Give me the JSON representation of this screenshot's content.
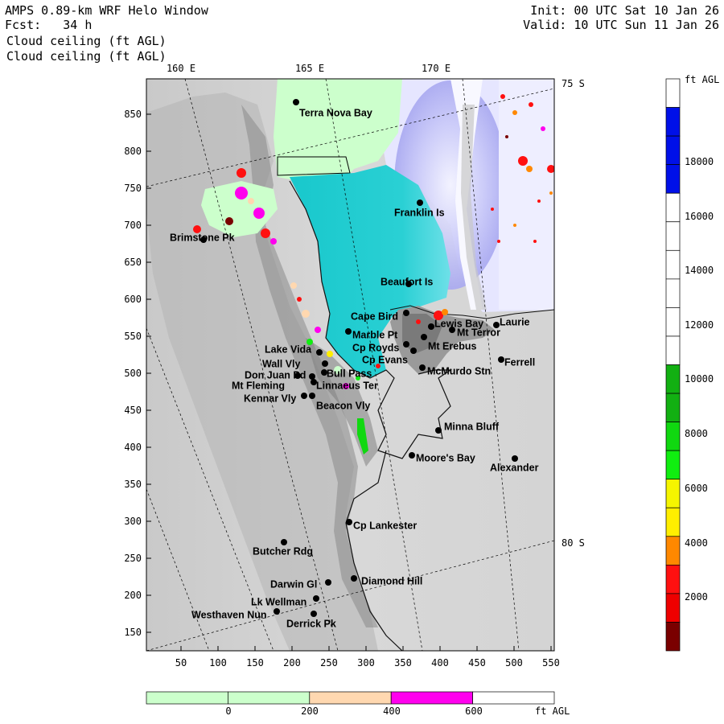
{
  "header": {
    "title": "AMPS 0.89-km WRF Helo Window",
    "forecast": "Fcst:   34 h",
    "field_line1": "Cloud ceiling (ft AGL)",
    "field_line2": "Cloud ceiling (ft AGL)",
    "init": "Init: 00 UTC Sat 10 Jan 26",
    "valid": "Valid: 10 UTC Sun 11 Jan 26"
  },
  "map": {
    "lon_labels": [
      "160 E",
      "165 E",
      "170 E"
    ],
    "lat_labels": [
      "75 S",
      "80 S"
    ],
    "x_ticks": [
      "50",
      "100",
      "150",
      "200",
      "250",
      "300",
      "350",
      "400",
      "450",
      "500",
      "550"
    ],
    "y_ticks": [
      "850",
      "800",
      "750",
      "700",
      "650",
      "600",
      "550",
      "500",
      "450",
      "400",
      "350",
      "300",
      "250",
      "200",
      "150"
    ],
    "places": [
      {
        "name": "Terra Nova Bay"
      },
      {
        "name": "Franklin Is"
      },
      {
        "name": "Brimstone Pk"
      },
      {
        "name": "Beaufort Is"
      },
      {
        "name": "Cape Bird"
      },
      {
        "name": "Lewis Bay"
      },
      {
        "name": "Laurie"
      },
      {
        "name": "Mt Terror"
      },
      {
        "name": "Marble Pt"
      },
      {
        "name": "Cp Royds"
      },
      {
        "name": "Mt Erebus"
      },
      {
        "name": "Lake Vida"
      },
      {
        "name": "Cp Evans"
      },
      {
        "name": "Ferrell"
      },
      {
        "name": "Wall Vly"
      },
      {
        "name": "Bull Pass"
      },
      {
        "name": "McMurdo Stn"
      },
      {
        "name": "Don Juan Pd"
      },
      {
        "name": "Mt Fleming"
      },
      {
        "name": "Linnaeus Ter"
      },
      {
        "name": "Kennar Vly"
      },
      {
        "name": "Beacon Vly"
      },
      {
        "name": "Minna Bluff"
      },
      {
        "name": "Moore's Bay"
      },
      {
        "name": "Alexander"
      },
      {
        "name": "Cp Lankester"
      },
      {
        "name": "Butcher Rdg"
      },
      {
        "name": "Darwin Gl"
      },
      {
        "name": "Diamond Hill"
      },
      {
        "name": "Lk Wellman"
      },
      {
        "name": "Westhaven Nun"
      },
      {
        "name": "Derrick Pk"
      }
    ]
  },
  "colorbar_right": {
    "unit": "ft AGL",
    "labels": [
      "18000",
      "16000",
      "14000",
      "12000",
      "10000",
      "8000",
      "6000",
      "4000",
      "2000"
    ],
    "colors": [
      "#ffffff",
      "#0010e8",
      "#0010e8",
      "#0010e8",
      "#ffffff",
      "#ffffff",
      "#ffffff",
      "#ffffff",
      "#ffffff",
      "#ffffff",
      "#12b012",
      "#12b012",
      "#10d810",
      "#10ee10",
      "#f5f500",
      "#ffee00",
      "#ff8800",
      "#ff1010",
      "#ee0000",
      "#7a0000"
    ]
  },
  "colorbar_bottom": {
    "unit": "ft AGL",
    "labels": [
      "0",
      "200",
      "400",
      "600"
    ],
    "colors": [
      "#ccffcc",
      "#ccffcc",
      "#ffd8b0",
      "#ff00ee",
      "#ffffff"
    ]
  }
}
